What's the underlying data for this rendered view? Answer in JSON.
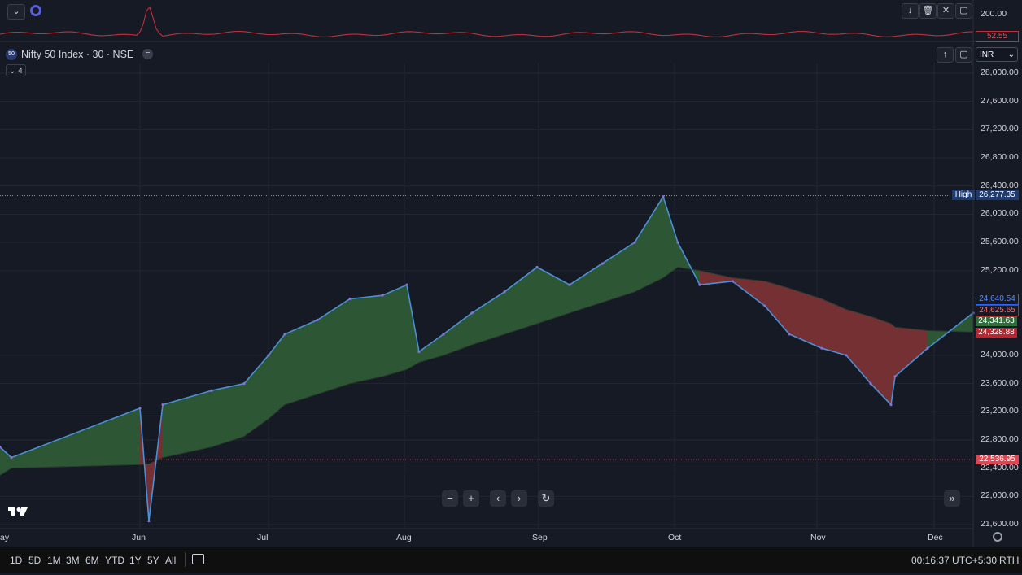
{
  "indicator_pane": {
    "scale_label": "200.00",
    "last_value": "52.55"
  },
  "symbol": {
    "badge": "50",
    "title": "Nifty 50 Index · 30 · NSE",
    "collapsed_count": "4"
  },
  "currency": "INR",
  "price_axis": {
    "labels": [
      "28,000.00",
      "27,600.00",
      "27,200.00",
      "26,800.00",
      "26,400.00",
      "26,000.00",
      "25,600.00",
      "25,200.00",
      "24,000.00",
      "23,600.00",
      "23,200.00",
      "22,800.00",
      "22,400.00",
      "22,000.00",
      "21,600.00"
    ]
  },
  "price_tags": {
    "high_label": "High",
    "high_value": "26,277.35",
    "tag1": "24,640.54",
    "tag2": "24,625.65",
    "tag3": "24,341.63",
    "tag4": "24,328.88",
    "low_line": "22,536.95"
  },
  "time_axis": {
    "labels": [
      "ay",
      "Jun",
      "Jul",
      "Aug",
      "Sep",
      "Oct",
      "Nov",
      "Dec"
    ]
  },
  "bottom_bar": {
    "ranges": [
      "1D",
      "5D",
      "1M",
      "3M",
      "6M",
      "YTD",
      "1Y",
      "5Y",
      "All"
    ],
    "clock": "00:16:37 UTC+5:30",
    "session": "RTH"
  },
  "icons": {
    "collapse": "chevron-down-icon",
    "settings": "gear-icon",
    "logo": "tradingview-logo-icon",
    "zoom_out": "minus-icon",
    "zoom_in": "plus-icon",
    "scroll_left": "chevron-left-icon",
    "scroll_right": "chevron-right-icon",
    "reset": "reset-icon",
    "go_to_realtime": "double-chevron-right-icon",
    "date_range": "calendar-icon"
  },
  "colors": {
    "background": "#161a25",
    "up_fill": "#2e5a35",
    "down_fill": "#7a3135",
    "price_line": "#4a90d9",
    "indicator_line": "#c0303a",
    "tag_blue": "#1e3a6e",
    "tag_red": "#b22833",
    "tag_green": "#2f6f3a"
  },
  "chart_data": {
    "type": "area",
    "title": "Nifty 50 Index · 30 · NSE",
    "xlabel": "",
    "ylabel": "",
    "ylim": [
      21500,
      28200
    ],
    "x": [
      "May 27",
      "May 31",
      "Jun 3",
      "Jun 4",
      "Jun 7",
      "Jun 14",
      "Jun 21",
      "Jun 28",
      "Jul 5",
      "Jul 12",
      "Jul 19",
      "Jul 26",
      "Aug 1",
      "Aug 5",
      "Aug 9",
      "Aug 16",
      "Aug 23",
      "Aug 30",
      "Sep 6",
      "Sep 13",
      "Sep 20",
      "Sep 27",
      "Oct 1",
      "Oct 4",
      "Oct 11",
      "Oct 18",
      "Oct 25",
      "Nov 1",
      "Nov 8",
      "Nov 14",
      "Nov 21",
      "Nov 22",
      "Nov 29",
      "Dec 4"
    ],
    "series": [
      {
        "values": [
          22700,
          22550,
          23250,
          21650,
          23300,
          23500,
          23600,
          24000,
          24300,
          24500,
          24800,
          24850,
          25000,
          24050,
          24300,
          24600,
          24900,
          25250,
          25000,
          25300,
          25600,
          26250,
          25600,
          25000,
          25050,
          24700,
          24300,
          24100,
          24000,
          23600,
          23300,
          23700,
          24100,
          24600
        ]
      },
      {
        "values": [
          22300,
          22400,
          22450,
          22460,
          22550,
          22700,
          22850,
          23100,
          23300,
          23450,
          23600,
          23700,
          23800,
          23900,
          24000,
          24150,
          24300,
          24450,
          24600,
          24750,
          24900,
          25100,
          25250,
          25200,
          25100,
          25050,
          24950,
          24800,
          24650,
          24550,
          24450,
          24400,
          24350,
          24330
        ]
      }
    ]
  }
}
